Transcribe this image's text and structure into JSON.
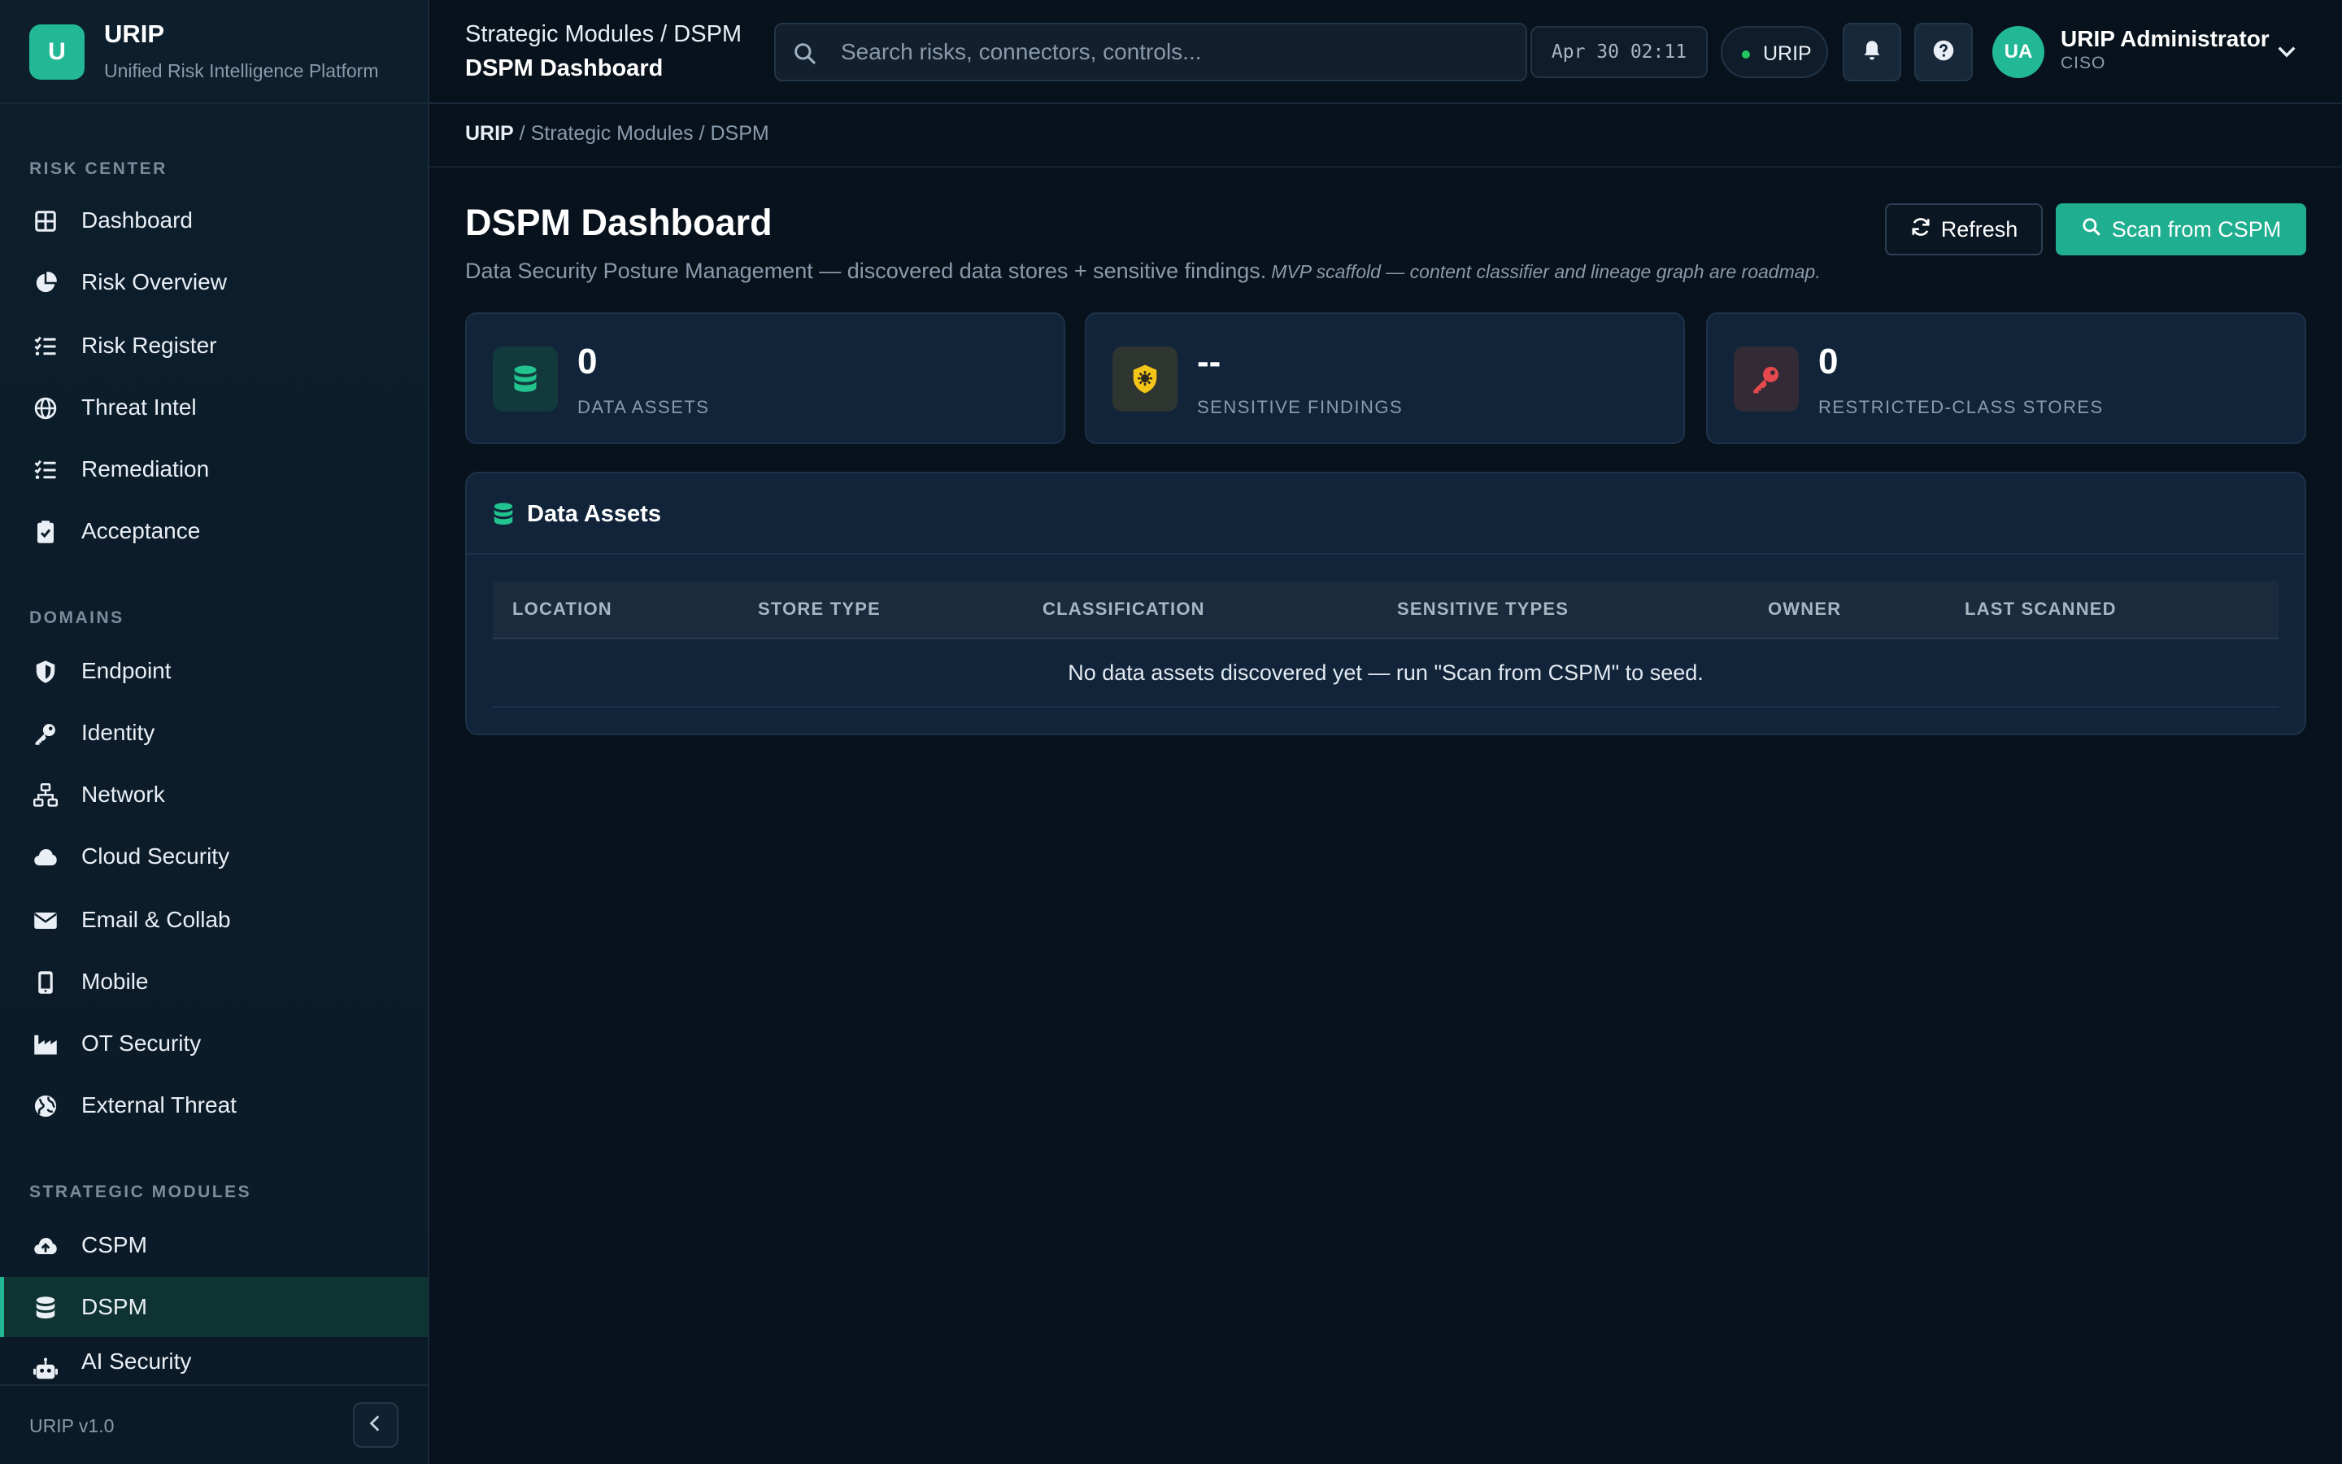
{
  "brand": {
    "logo_letter": "U",
    "name": "URIP",
    "subtitle": "Unified Risk Intelligence Platform"
  },
  "sidebar": {
    "sections": [
      {
        "title": "RISK CENTER"
      },
      {
        "title": "DOMAINS"
      },
      {
        "title": "STRATEGIC MODULES"
      }
    ],
    "items": [
      {
        "label": "Dashboard",
        "icon": "grid-icon"
      },
      {
        "label": "Risk Overview",
        "icon": "pie-chart-icon"
      },
      {
        "label": "Risk Register",
        "icon": "list-check-icon"
      },
      {
        "label": "Threat Intel",
        "icon": "globe-icon"
      },
      {
        "label": "Remediation",
        "icon": "list-check-icon"
      },
      {
        "label": "Acceptance",
        "icon": "clipboard-check-icon"
      },
      {
        "label": "Endpoint",
        "icon": "shield-icon"
      },
      {
        "label": "Identity",
        "icon": "key-icon"
      },
      {
        "label": "Network",
        "icon": "network-icon"
      },
      {
        "label": "Cloud Security",
        "icon": "cloud-icon"
      },
      {
        "label": "Email & Collab",
        "icon": "envelope-icon"
      },
      {
        "label": "Mobile",
        "icon": "mobile-icon"
      },
      {
        "label": "OT Security",
        "icon": "industry-icon"
      },
      {
        "label": "External Threat",
        "icon": "globe-alt-icon"
      },
      {
        "label": "CSPM",
        "icon": "cloud-upload-icon"
      },
      {
        "label": "DSPM",
        "icon": "database-icon",
        "active": true
      },
      {
        "label": "AI Security",
        "icon": "robot-icon"
      }
    ],
    "version": "URIP v1.0"
  },
  "topbar": {
    "breadcrumb": "Strategic Modules / DSPM",
    "title": "DSPM Dashboard",
    "search_placeholder": "Search risks, connectors, controls...",
    "clock": "Apr 30 02:11",
    "tenant": "URIP",
    "user": {
      "initials": "UA",
      "name": "URIP Administrator",
      "role": "CISO"
    }
  },
  "crumbbar": {
    "root": "URIP",
    "rest": " / Strategic Modules / DSPM"
  },
  "main": {
    "title": "DSPM Dashboard",
    "subtitle": "Data Security Posture Management — discovered data stores + sensitive findings.",
    "note": "MVP scaffold — content classifier and lineage graph are roadmap.",
    "refresh_label": "Refresh",
    "scan_label": "Scan from CSPM"
  },
  "stats": [
    {
      "value": "0",
      "label": "DATA ASSETS",
      "icon": "database-icon",
      "color": "#22c38e"
    },
    {
      "value": "--",
      "label": "SENSITIVE FINDINGS",
      "icon": "shield-virus-icon",
      "color": "#f5c518"
    },
    {
      "value": "0",
      "label": "RESTRICTED-CLASS STORES",
      "icon": "key-icon",
      "color": "#e5484d"
    }
  ],
  "assets_panel": {
    "title": "Data Assets",
    "columns": [
      "LOCATION",
      "STORE TYPE",
      "CLASSIFICATION",
      "SENSITIVE TYPES",
      "OWNER",
      "LAST SCANNED"
    ],
    "empty_message": "No data assets discovered yet — run \"Scan from CSPM\" to seed."
  },
  "colors": {
    "accent": "#22b895",
    "background": "#08121d",
    "card": "#11243a"
  }
}
